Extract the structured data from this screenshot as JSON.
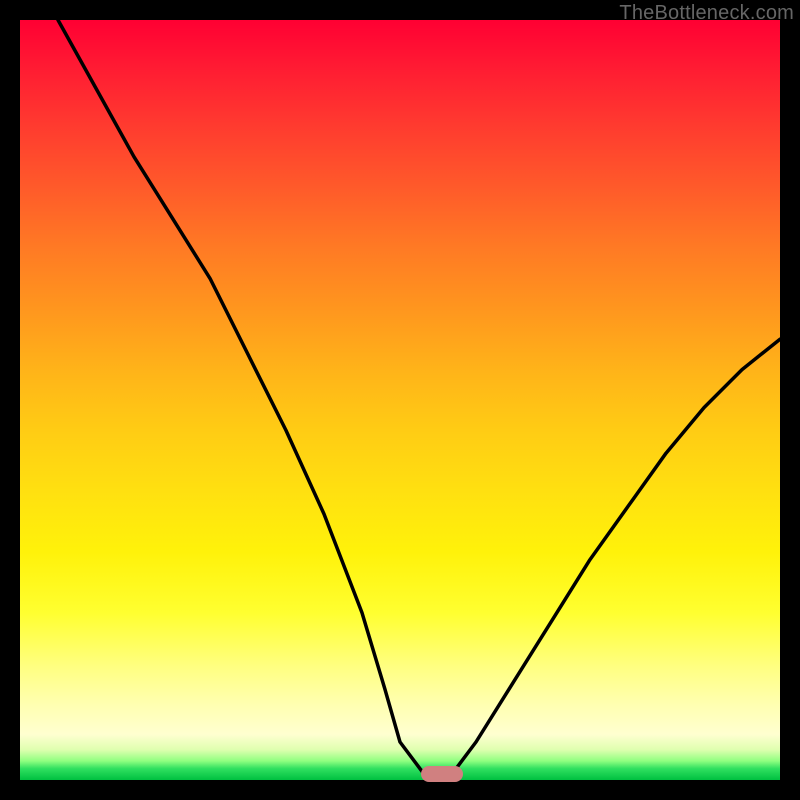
{
  "watermark": "TheBottleneck.com",
  "colors": {
    "frame": "#000000",
    "curve": "#000000",
    "marker": "#d08080"
  },
  "chart_data": {
    "type": "line",
    "title": "",
    "xlabel": "",
    "ylabel": "",
    "xlim": [
      0,
      100
    ],
    "ylim": [
      0,
      100
    ],
    "notes": "Bottleneck-style V-curve over a red→green vertical gradient. Values are read in percent of the plot area: x left→right, y bottom→top.",
    "series": [
      {
        "name": "bottleneck-curve",
        "x": [
          5,
          10,
          15,
          20,
          25,
          30,
          35,
          40,
          45,
          48,
          50,
          53,
          55,
          57,
          60,
          65,
          70,
          75,
          80,
          85,
          90,
          95,
          100
        ],
        "y": [
          100,
          91,
          82,
          74,
          66,
          56,
          46,
          35,
          22,
          12,
          5,
          1,
          0,
          1,
          5,
          13,
          21,
          29,
          36,
          43,
          49,
          54,
          58
        ]
      }
    ],
    "marker": {
      "x": 55.5,
      "y": 0.8,
      "shape": "pill",
      "color": "#d08080"
    },
    "gradient_stops": [
      {
        "pct": 0,
        "color": "#ff0033"
      },
      {
        "pct": 22,
        "color": "#ff5a2a"
      },
      {
        "pct": 46,
        "color": "#ffb319"
      },
      {
        "pct": 70,
        "color": "#fff20a"
      },
      {
        "pct": 90,
        "color": "#ffffb0"
      },
      {
        "pct": 97,
        "color": "#8fff80"
      },
      {
        "pct": 100,
        "color": "#00c040"
      }
    ]
  }
}
